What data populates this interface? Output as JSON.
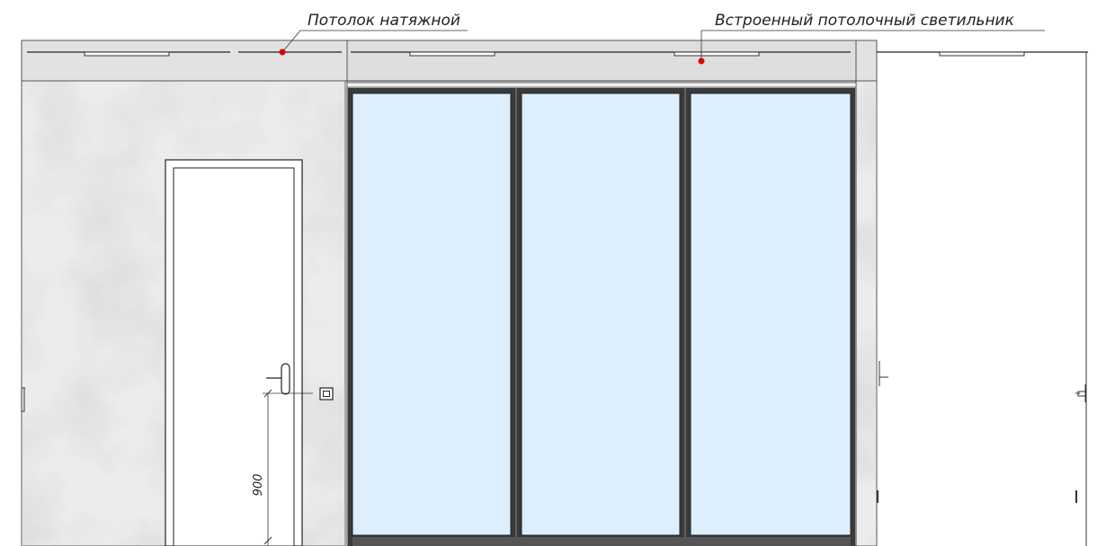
{
  "annotations": {
    "ceiling_label": "Потолок натяжной",
    "light_label": "Встроенный потолочный светильник"
  },
  "dimensions": {
    "switch_height": "900"
  },
  "colors": {
    "wall": "#e9eaea",
    "glass": "#ddeefc",
    "frame": "#3a3a3a",
    "ceiling_band": "#e0e0e0",
    "marker": "#e00000",
    "line": "#333333"
  },
  "icons": {
    "door": "door-icon",
    "handle": "door-handle-icon",
    "switch": "light-switch-icon"
  }
}
